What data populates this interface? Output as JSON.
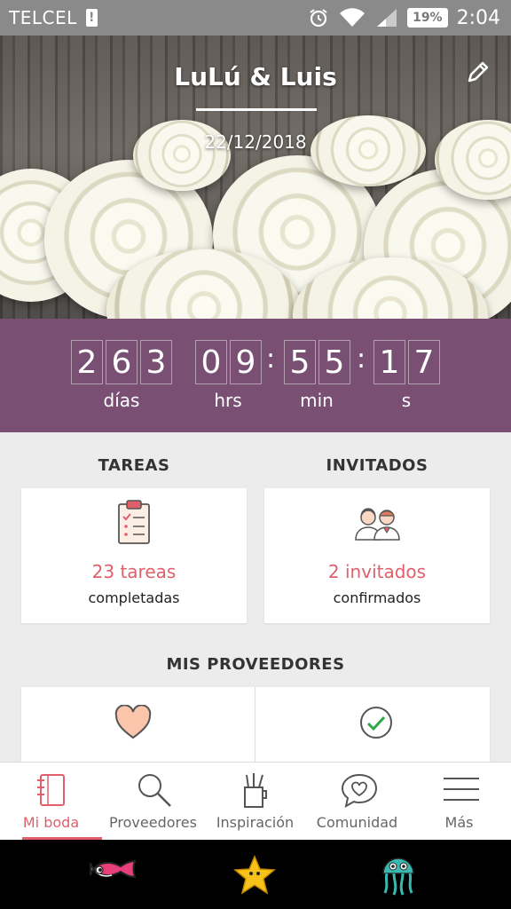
{
  "status_bar": {
    "carrier": "TELCEL",
    "sim_icon": "!",
    "battery_percent": "19%",
    "time": "2:04",
    "icons": [
      "alarm-icon",
      "wifi-icon",
      "signal-icon",
      "battery-icon"
    ]
  },
  "header": {
    "couple_names": "LuLú & Luis",
    "wedding_date": "22/12/2018",
    "edit_icon": "pencil-icon"
  },
  "countdown": {
    "days_digits": [
      "2",
      "6",
      "3"
    ],
    "hours_digits": [
      "0",
      "9"
    ],
    "minutes_digits": [
      "5",
      "5"
    ],
    "seconds_digits": [
      "1",
      "7"
    ],
    "separator": ":",
    "days_label": "días",
    "hours_label": "hrs",
    "minutes_label": "min",
    "seconds_label": "s"
  },
  "tasks": {
    "section_title": "TAREAS",
    "count_text": "23 tareas",
    "sub_text": "completadas",
    "icon": "clipboard-checklist-icon"
  },
  "guests": {
    "section_title": "INVITADOS",
    "count_text": "2 invitados",
    "sub_text": "confirmados",
    "icon": "couple-icon"
  },
  "providers": {
    "section_title": "MIS PROVEEDORES",
    "icons": [
      "heart-icon",
      "checkmark-circle-icon"
    ]
  },
  "tab_bar": {
    "items": [
      {
        "label": "Mi boda",
        "icon": "notebook-icon",
        "active": true
      },
      {
        "label": "Proveedores",
        "icon": "search-icon",
        "active": false
      },
      {
        "label": "Inspiración",
        "icon": "pencil-cup-icon",
        "active": false
      },
      {
        "label": "Comunidad",
        "icon": "chat-heart-icon",
        "active": false
      },
      {
        "label": "Más",
        "icon": "menu-icon",
        "active": false
      }
    ]
  },
  "nav_bar": {
    "icons": [
      "fish-icon",
      "starfish-icon",
      "jellyfish-icon"
    ]
  },
  "colors": {
    "accent": "#e05f6b",
    "countdown_bg": "#7a4f74",
    "status_bar_bg": "#8a8a8a"
  }
}
